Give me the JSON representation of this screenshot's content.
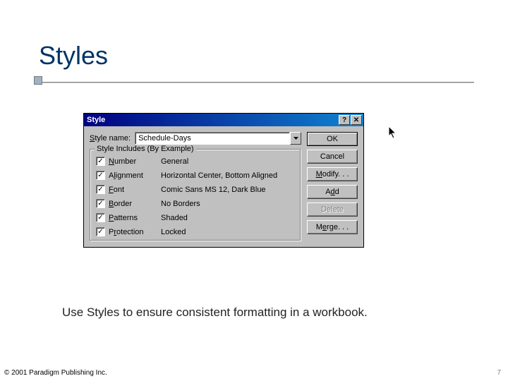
{
  "slide": {
    "title": "Styles",
    "caption": "Use Styles to ensure consistent formatting in a workbook.",
    "copyright": "© 2001 Paradigm Publishing Inc.",
    "pagenum": "7"
  },
  "dialog": {
    "title": "Style",
    "style_name_label_pre": "S",
    "style_name_label_post": "tyle name:",
    "style_name_value": "Schedule-Days",
    "group_label": "Style Includes (By Example)",
    "items": [
      {
        "u": "N",
        "rest": "umber",
        "desc": "General"
      },
      {
        "u": "A",
        "pre": "Alignmen",
        "u2": "l",
        "rest": "",
        "label_raw": "Alignment",
        "desc": "Horizontal Center, Bottom Aligned"
      },
      {
        "u": "F",
        "rest": "ont",
        "desc": "Comic Sans MS 12, Dark Blue"
      },
      {
        "u": "B",
        "rest": "order",
        "desc": "No Borders"
      },
      {
        "u": "P",
        "rest": "atterns",
        "desc": "Shaded"
      },
      {
        "u": "P",
        "pre": "P",
        "u2": "r",
        "rest2": "otection",
        "label_raw": "Protection",
        "desc": "Locked"
      }
    ],
    "buttons": {
      "ok": "OK",
      "cancel": "Cancel",
      "modify": "Modify. . .",
      "add_pre": "A",
      "add_u": "d",
      "add_post": "d",
      "delete": "Delete",
      "merge_pre": "M",
      "merge_u": "e",
      "merge_post": "rge. . ."
    }
  }
}
